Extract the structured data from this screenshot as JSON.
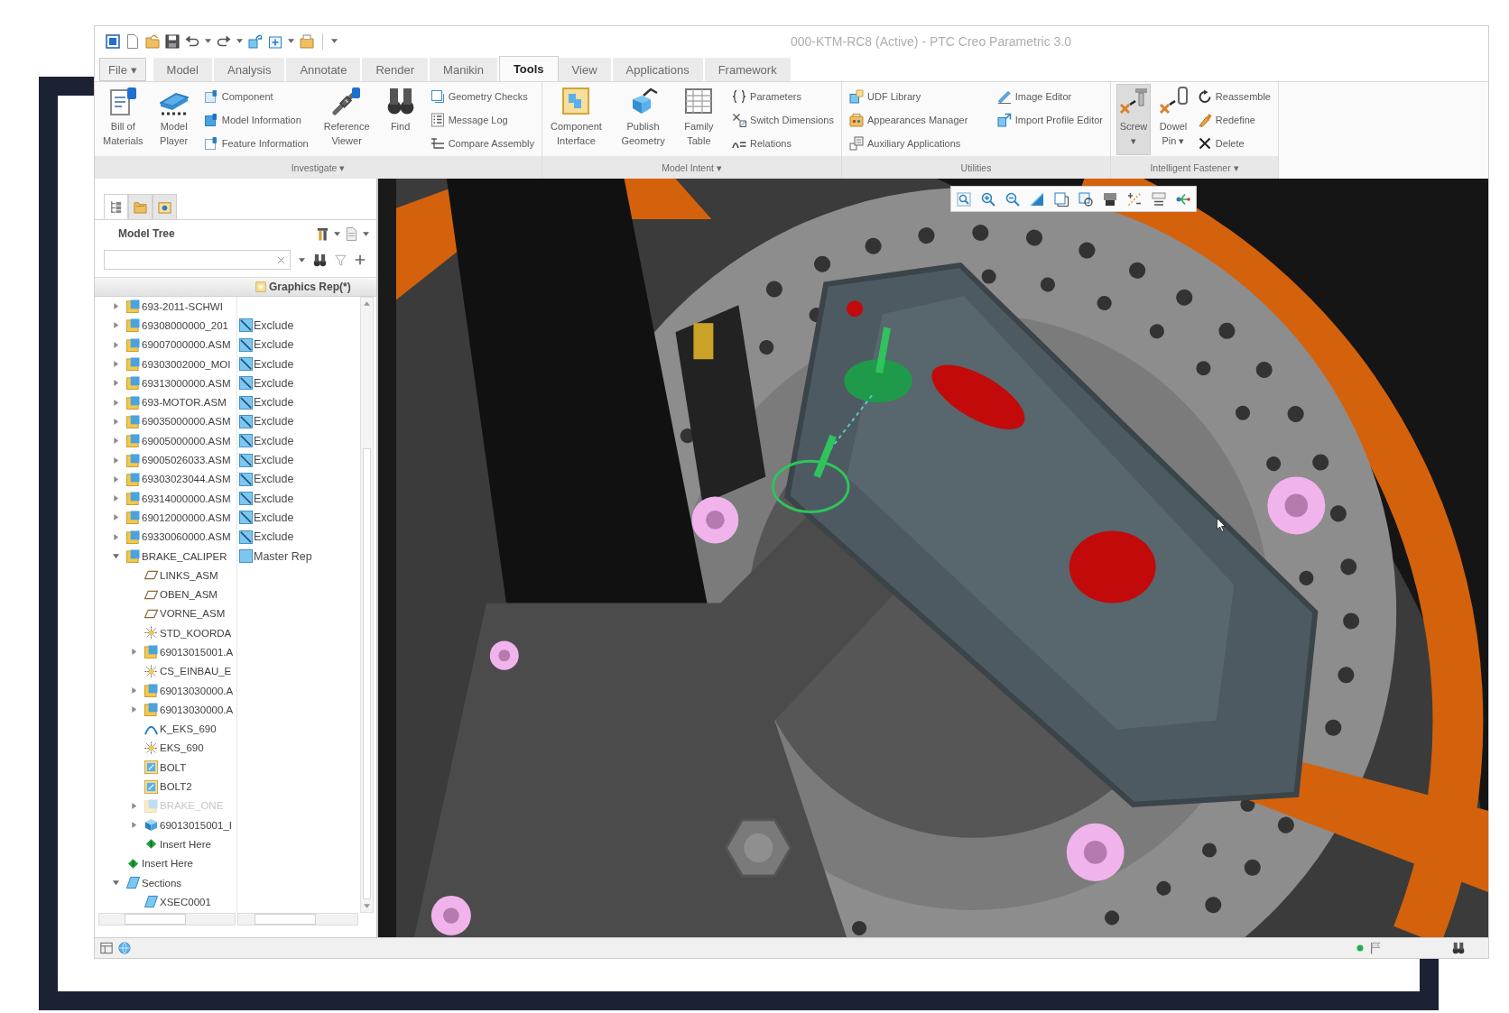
{
  "window": {
    "title": "000-KTM-RC8 (Active) - PTC Creo Parametric 3.0"
  },
  "tabs": [
    {
      "label": "File ▾",
      "kind": "menu",
      "selected": false
    },
    {
      "label": "Model",
      "kind": "tab",
      "selected": false
    },
    {
      "label": "Analysis",
      "kind": "tab",
      "selected": false
    },
    {
      "label": "Annotate",
      "kind": "tab",
      "selected": false
    },
    {
      "label": "Render",
      "kind": "tab",
      "selected": false
    },
    {
      "label": "Manikin",
      "kind": "tab",
      "selected": false
    },
    {
      "label": "Tools",
      "kind": "tab",
      "selected": true
    },
    {
      "label": "View",
      "kind": "tab",
      "selected": false
    },
    {
      "label": "Applications",
      "kind": "tab",
      "selected": false
    },
    {
      "label": "Framework",
      "kind": "tab",
      "selected": false
    }
  ],
  "ribbon": {
    "groups": [
      {
        "label": "Investigate ▾",
        "controls": [
          {
            "kind": "large",
            "lines": [
              "Bill of",
              "Materials"
            ],
            "highlighted": false
          },
          {
            "kind": "large",
            "lines": [
              "Model",
              "Player"
            ],
            "highlighted": false
          },
          {
            "kind": "stack",
            "items": [
              {
                "label": "Component"
              },
              {
                "label": "Model Information"
              },
              {
                "label": "Feature Information"
              }
            ]
          },
          {
            "kind": "large",
            "lines": [
              "Reference",
              "Viewer"
            ],
            "highlighted": false
          },
          {
            "kind": "large",
            "lines": [
              "Find"
            ],
            "highlighted": false
          },
          {
            "kind": "stack",
            "items": [
              {
                "label": "Geometry Checks"
              },
              {
                "label": "Message Log"
              },
              {
                "label": "Compare Assembly"
              }
            ]
          }
        ]
      },
      {
        "label": "Model Intent ▾",
        "controls": [
          {
            "kind": "large",
            "lines": [
              "Component",
              "Interface"
            ],
            "highlighted": false
          },
          {
            "kind": "large",
            "lines": [
              "Publish",
              "Geometry"
            ],
            "highlighted": false
          },
          {
            "kind": "large",
            "lines": [
              "Family",
              "Table"
            ],
            "highlighted": false
          },
          {
            "kind": "stack",
            "items": [
              {
                "label": "Parameters"
              },
              {
                "label": "Switch Dimensions"
              },
              {
                "label": "Relations"
              }
            ]
          }
        ]
      },
      {
        "label": "Utilities",
        "controls": [
          {
            "kind": "stack",
            "items": [
              {
                "label": "UDF Library"
              },
              {
                "label": "Appearances Manager"
              },
              {
                "label": "Auxiliary Applications"
              }
            ]
          },
          {
            "kind": "stack",
            "items": [
              {
                "label": "Image Editor"
              },
              {
                "label": "Import Profile Editor"
              }
            ]
          }
        ]
      },
      {
        "label": "Intelligent Fastener ▾",
        "controls": [
          {
            "kind": "large",
            "lines": [
              "Screw",
              "▾"
            ],
            "highlighted": true
          },
          {
            "kind": "large",
            "lines": [
              "Dowel",
              "Pin ▾"
            ],
            "highlighted": false
          },
          {
            "kind": "stack",
            "items": [
              {
                "label": "Reassemble"
              },
              {
                "label": "Redefine"
              },
              {
                "label": "Delete"
              }
            ]
          }
        ]
      }
    ]
  },
  "model_tree": {
    "panel_tabs": [
      {
        "selected": true
      },
      {
        "selected": false
      },
      {
        "selected": false
      }
    ],
    "title": "Model Tree",
    "column_header": "Graphics Rep(*)",
    "items": [
      {
        "name": "693-2011-SCHWI",
        "kind": "assembly",
        "expanded": false
      },
      {
        "name": "69308000000_201",
        "kind": "assembly",
        "expanded": false,
        "rep": {
          "kind": "exclude",
          "text": "Exclude"
        }
      },
      {
        "name": "69007000000.ASM",
        "kind": "assembly",
        "expanded": false,
        "rep": {
          "kind": "exclude",
          "text": "Exclude"
        }
      },
      {
        "name": "69303002000_MOI",
        "kind": "assembly",
        "expanded": false,
        "rep": {
          "kind": "exclude",
          "text": "Exclude"
        }
      },
      {
        "name": "69313000000.ASM",
        "kind": "assembly",
        "expanded": false,
        "rep": {
          "kind": "exclude",
          "text": "Exclude"
        }
      },
      {
        "name": "693-MOTOR.ASM",
        "kind": "assembly",
        "expanded": false,
        "rep": {
          "kind": "exclude",
          "text": "Exclude"
        }
      },
      {
        "name": "69035000000.ASM",
        "kind": "assembly",
        "expanded": false,
        "rep": {
          "kind": "exclude",
          "text": "Exclude"
        }
      },
      {
        "name": "69005000000.ASM",
        "kind": "assembly",
        "expanded": false,
        "rep": {
          "kind": "exclude",
          "text": "Exclude"
        }
      },
      {
        "name": "69005026033.ASM",
        "kind": "assembly",
        "expanded": false,
        "rep": {
          "kind": "exclude",
          "text": "Exclude"
        }
      },
      {
        "name": "69303023044.ASM",
        "kind": "assembly",
        "expanded": false,
        "rep": {
          "kind": "exclude",
          "text": "Exclude"
        }
      },
      {
        "name": "69314000000.ASM",
        "kind": "assembly",
        "expanded": false,
        "rep": {
          "kind": "exclude",
          "text": "Exclude"
        }
      },
      {
        "name": "69012000000.ASM",
        "kind": "assembly",
        "expanded": false,
        "rep": {
          "kind": "exclude",
          "text": "Exclude"
        }
      },
      {
        "name": "69330060000.ASM",
        "kind": "assembly",
        "expanded": false,
        "rep": {
          "kind": "exclude",
          "text": "Exclude"
        }
      },
      {
        "name": "BRAKE_CALIPER",
        "kind": "assembly",
        "expanded": true,
        "rep": {
          "kind": "master",
          "text": "Master Rep"
        },
        "children": [
          {
            "name": "LINKS_ASM",
            "kind": "datum-plane",
            "disabled": false
          },
          {
            "name": "OBEN_ASM",
            "kind": "datum-plane",
            "disabled": false
          },
          {
            "name": "VORNE_ASM",
            "kind": "datum-plane",
            "disabled": false
          },
          {
            "name": "STD_KOORDA",
            "kind": "csys",
            "disabled": false
          },
          {
            "name": "69013015001.A",
            "kind": "assembly",
            "expanded": false,
            "disabled": false
          },
          {
            "name": "CS_EINBAU_E",
            "kind": "csys",
            "disabled": false
          },
          {
            "name": "69013030000.A",
            "kind": "assembly",
            "expanded": false,
            "disabled": false
          },
          {
            "name": "69013030000.A",
            "kind": "assembly",
            "expanded": false,
            "disabled": false
          },
          {
            "name": "K_EKS_690",
            "kind": "curve",
            "disabled": false
          },
          {
            "name": "EKS_690",
            "kind": "csys",
            "disabled": false
          },
          {
            "name": "BOLT",
            "kind": "fastener",
            "disabled": false
          },
          {
            "name": "BOLT2",
            "kind": "fastener",
            "disabled": false
          },
          {
            "name": "BRAKE_ONE",
            "kind": "assembly",
            "expanded": false,
            "disabled": true
          },
          {
            "name": "69013015001_I",
            "kind": "part",
            "expanded": false,
            "disabled": false
          },
          {
            "name": "Insert Here",
            "kind": "insert",
            "disabled": false
          }
        ]
      },
      {
        "name": "Insert Here",
        "kind": "insert"
      },
      {
        "name": "Sections",
        "kind": "section",
        "expanded": true,
        "children": [
          {
            "name": "XSEC0001",
            "kind": "section"
          }
        ]
      }
    ]
  }
}
